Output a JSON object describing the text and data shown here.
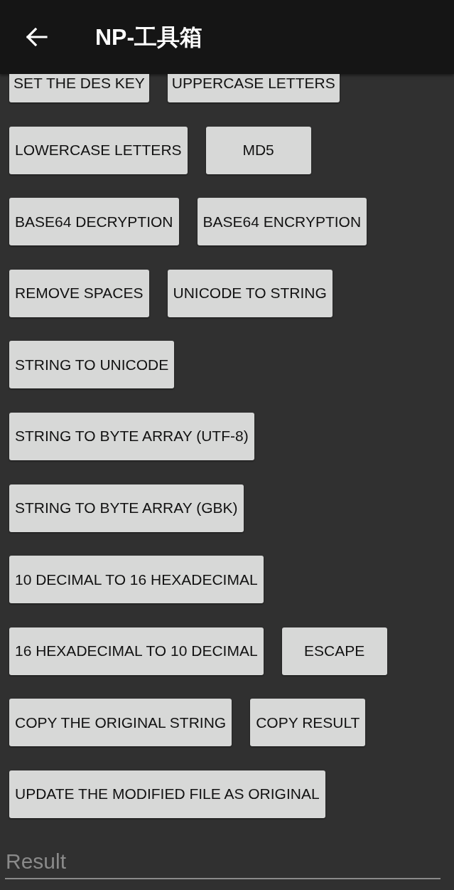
{
  "app_bar": {
    "title": "NP-工具箱"
  },
  "button_rows": [
    {
      "buttons": [
        {
          "label": "SET THE DES KEY"
        },
        {
          "label": "UPPERCASE LETTERS"
        }
      ]
    },
    {
      "buttons": [
        {
          "label": "LOWERCASE LETTERS"
        },
        {
          "label": "MD5"
        }
      ]
    },
    {
      "buttons": [
        {
          "label": "BASE64 DECRYPTION"
        },
        {
          "label": "BASE64 ENCRYPTION"
        }
      ]
    },
    {
      "buttons": [
        {
          "label": "REMOVE SPACES"
        },
        {
          "label": "UNICODE TO STRING"
        }
      ]
    },
    {
      "buttons": [
        {
          "label": "STRING TO UNICODE"
        }
      ]
    },
    {
      "buttons": [
        {
          "label": "STRING TO BYTE ARRAY (UTF-8)"
        }
      ]
    },
    {
      "buttons": [
        {
          "label": "STRING TO BYTE ARRAY (GBK)"
        }
      ]
    },
    {
      "buttons": [
        {
          "label": "10 DECIMAL TO 16 HEXADECIMAL"
        }
      ]
    },
    {
      "buttons": [
        {
          "label": "16 HEXADECIMAL TO 10 DECIMAL"
        },
        {
          "label": "ESCAPE"
        }
      ]
    },
    {
      "buttons": [
        {
          "label": "COPY THE ORIGINAL STRING"
        },
        {
          "label": "COPY RESULT"
        }
      ]
    },
    {
      "buttons": [
        {
          "label": "UPDATE THE MODIFIED FILE AS ORIGINAL"
        }
      ]
    }
  ],
  "result_field": {
    "placeholder": "Result"
  }
}
